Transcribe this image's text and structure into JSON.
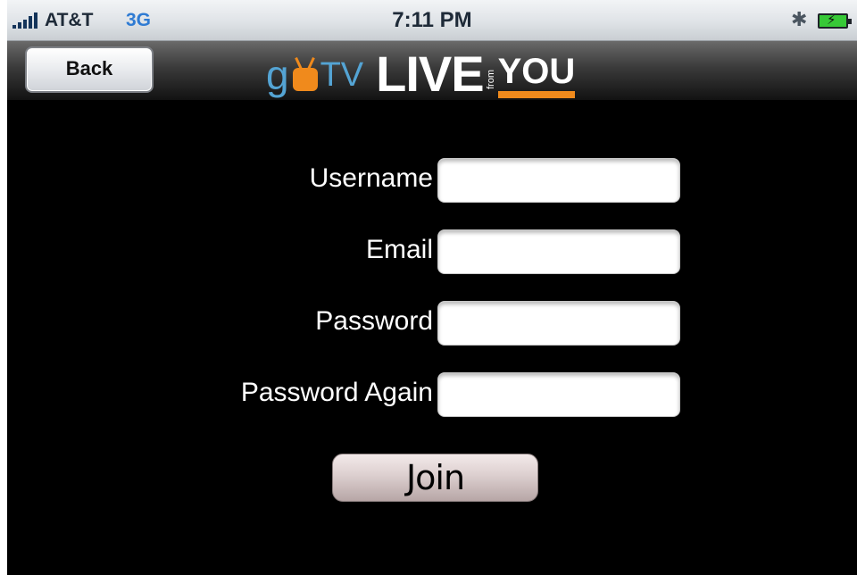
{
  "status_bar": {
    "carrier": "AT&T",
    "network": "3G",
    "time": "7:11 PM",
    "icons": [
      "signal-bars-icon",
      "bluetooth-icon",
      "battery-charging-icon"
    ]
  },
  "nav": {
    "back_label": "Back",
    "logo": {
      "go": "g",
      "tv": "TV",
      "live": "LIVE",
      "from": "from",
      "you": "YOU"
    }
  },
  "form": {
    "fields": [
      {
        "label": "Username",
        "value": "",
        "placeholder": ""
      },
      {
        "label": "Email",
        "value": "",
        "placeholder": ""
      },
      {
        "label": "Password",
        "value": "",
        "placeholder": ""
      },
      {
        "label": "Password Again",
        "value": "",
        "placeholder": ""
      }
    ],
    "join_label": "Join"
  },
  "colors": {
    "logo_blue": "#54a4d4",
    "logo_orange": "#f08a1c",
    "network_blue": "#2f7bd3",
    "background": "#000000"
  }
}
